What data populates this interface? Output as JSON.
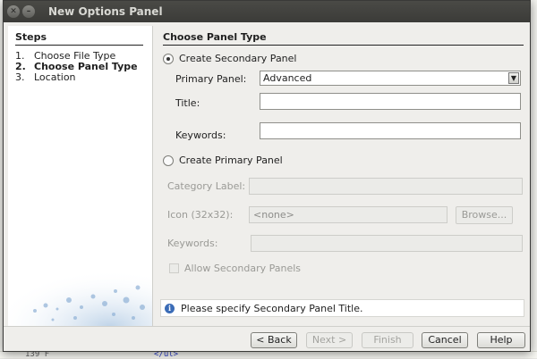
{
  "window": {
    "title": "New Options Panel"
  },
  "steps": {
    "header": "Steps",
    "items": [
      {
        "num": "1.",
        "label": "Choose File Type",
        "active": false
      },
      {
        "num": "2.",
        "label": "Choose Panel Type",
        "active": true
      },
      {
        "num": "3.",
        "label": "Location",
        "active": false
      }
    ]
  },
  "content": {
    "header": "Choose Panel Type",
    "secondary": {
      "radio_label": "Create Secondary Panel",
      "selected": true,
      "primary_panel_label": "Primary Panel:",
      "primary_panel_value": "Advanced",
      "title_label": "Title:",
      "title_value": "",
      "keywords_label": "Keywords:",
      "keywords_value": ""
    },
    "primary": {
      "radio_label": "Create Primary Panel",
      "selected": false,
      "category_label": "Category Label:",
      "icon_label": "Icon (32x32):",
      "icon_value": "<none>",
      "browse_label": "Browse...",
      "keywords_label": "Keywords:",
      "allow_secondary_label": "Allow Secondary Panels"
    },
    "info_message": "Please specify Secondary Panel Title."
  },
  "footer": {
    "back": "< Back",
    "next": "Next >",
    "finish": "Finish",
    "cancel": "Cancel",
    "help": "Help"
  },
  "background": {
    "line_number": "139",
    "line_marker": "F",
    "code_snippet": "</ul>"
  },
  "colors": {
    "titlebar": "#3b3b38",
    "info_icon": "#3b6cb7"
  }
}
